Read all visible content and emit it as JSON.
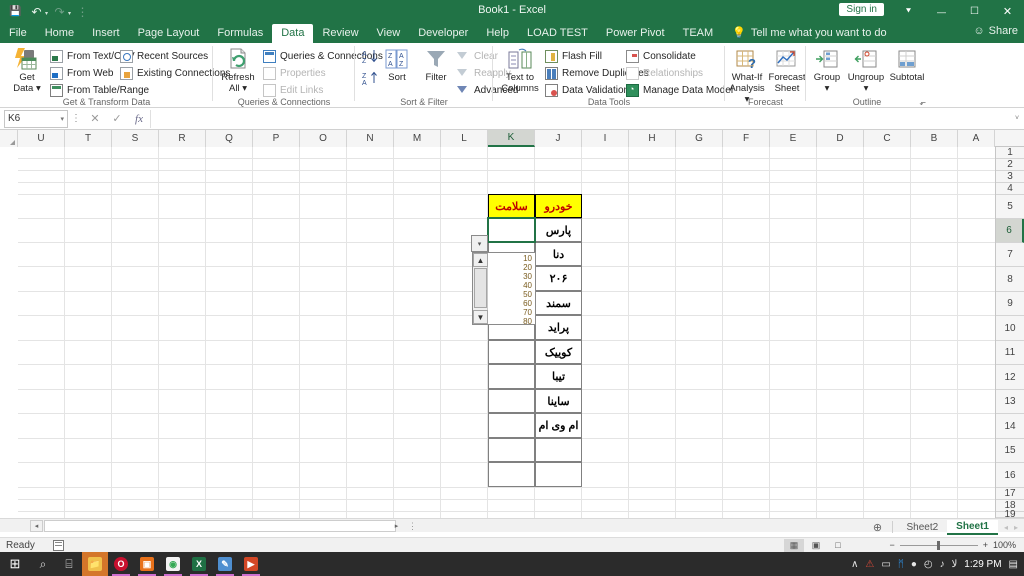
{
  "titlebar": {
    "app_title": "Book1  -  Excel",
    "signin_label": "Sign in",
    "quick_access": [
      {
        "name": "save-icon",
        "glyph": "💾"
      },
      {
        "name": "undo-icon",
        "glyph": "↶"
      },
      {
        "name": "redo-icon",
        "glyph": "↷"
      },
      {
        "name": "customize-qat-icon",
        "glyph": "⋮"
      }
    ],
    "window_buttons": [
      {
        "name": "ribbon-display-options-icon",
        "glyph": "⯆"
      },
      {
        "name": "minimize-icon",
        "glyph": "—"
      },
      {
        "name": "restore-icon",
        "glyph": "☐"
      },
      {
        "name": "close-icon",
        "glyph": "✕"
      }
    ],
    "share_label": "Share"
  },
  "tabs": [
    {
      "label": "File",
      "active": false
    },
    {
      "label": "Home",
      "active": false
    },
    {
      "label": "Insert",
      "active": false
    },
    {
      "label": "Page Layout",
      "active": false
    },
    {
      "label": "Formulas",
      "active": false
    },
    {
      "label": "Data",
      "active": true
    },
    {
      "label": "Review",
      "active": false
    },
    {
      "label": "View",
      "active": false
    },
    {
      "label": "Developer",
      "active": false
    },
    {
      "label": "Help",
      "active": false
    },
    {
      "label": "LOAD TEST",
      "active": false
    },
    {
      "label": "Power Pivot",
      "active": false
    },
    {
      "label": "TEAM",
      "active": false
    }
  ],
  "tell_me": "Tell me what you want to do",
  "ribbon": {
    "groups": [
      {
        "title": "Get & Transform Data"
      },
      {
        "title": "Queries & Connections"
      },
      {
        "title": "Sort & Filter"
      },
      {
        "title": "Data Tools"
      },
      {
        "title": "Forecast"
      },
      {
        "title": "Outline"
      }
    ],
    "get_data": {
      "line1": "Get",
      "line2": "Data",
      "caret": "▾"
    },
    "get_transform_items": [
      {
        "label": "From Text/CSV",
        "disabled": false
      },
      {
        "label": "From Web",
        "disabled": false
      },
      {
        "label": "From Table/Range",
        "disabled": false
      },
      {
        "label": "Recent Sources",
        "disabled": false
      },
      {
        "label": "Existing Connections",
        "disabled": false
      }
    ],
    "refresh_all": {
      "line1": "Refresh",
      "line2": "All ▾"
    },
    "queries_items": [
      {
        "label": "Queries & Connections",
        "disabled": false
      },
      {
        "label": "Properties",
        "disabled": true
      },
      {
        "label": "Edit Links",
        "disabled": true
      }
    ],
    "sort_label": "Sort",
    "filter_label": "Filter",
    "sort_filter_items": [
      {
        "label": "Clear",
        "disabled": true
      },
      {
        "label": "Reapply",
        "disabled": true
      },
      {
        "label": "Advanced",
        "disabled": false
      }
    ],
    "text_to_columns": {
      "line1": "Text to",
      "line2": "Columns"
    },
    "data_tools_items": [
      {
        "label": "Flash Fill",
        "disabled": false
      },
      {
        "label": "Remove Duplicates",
        "disabled": false
      },
      {
        "label": "Data Validation   ▾",
        "disabled": false
      },
      {
        "label": "Consolidate",
        "disabled": false
      },
      {
        "label": "Relationships",
        "disabled": true
      },
      {
        "label": "Manage Data Model",
        "disabled": false
      }
    ],
    "what_if": {
      "line1": "What-If",
      "line2": "Analysis ▾"
    },
    "forecast_sheet": {
      "line1": "Forecast",
      "line2": "Sheet"
    },
    "group_btn": {
      "line1": "Group",
      "line2": "▾"
    },
    "ungroup_btn": {
      "line1": "Ungroup",
      "line2": "▾"
    },
    "subtotal_btn": {
      "line1": "Subtotal",
      "line2": ""
    },
    "dialog_launcher": "⬐"
  },
  "formula_bar": {
    "name_box_value": "K6",
    "name_box_caret": "▾",
    "more_dots": "⋮",
    "cancel_icon": "✕",
    "enter_icon": "✓",
    "fx_icon": "fx",
    "formula_value": "",
    "expand_caret": "˅"
  },
  "grid": {
    "columns": [
      "U",
      "T",
      "S",
      "R",
      "Q",
      "P",
      "O",
      "N",
      "M",
      "L",
      "K",
      "J",
      "I",
      "H",
      "G",
      "F",
      "E",
      "D",
      "C",
      "B",
      "A"
    ],
    "selected_column": "K",
    "rows": [
      "1",
      "2",
      "3",
      "4",
      "5",
      "6",
      "7",
      "8",
      "9",
      "10",
      "11",
      "12",
      "13",
      "14",
      "15",
      "16",
      "17",
      "18",
      "19"
    ],
    "selected_row": "6",
    "active_cell": "K6",
    "header_cells": [
      {
        "ref": "K5",
        "text": "سلامت"
      },
      {
        "ref": "J5",
        "text": "خودرو"
      }
    ],
    "column_j_values": [
      {
        "ref": "J6",
        "text": "پارس"
      },
      {
        "ref": "J7",
        "text": "دنا"
      },
      {
        "ref": "J8",
        "text": "۲۰۶"
      },
      {
        "ref": "J9",
        "text": "سمند"
      },
      {
        "ref": "J10",
        "text": "پراید"
      },
      {
        "ref": "J11",
        "text": "کوییک"
      },
      {
        "ref": "J12",
        "text": "تیبا"
      },
      {
        "ref": "J13",
        "text": "ساینا"
      },
      {
        "ref": "J14",
        "text": "ام وی ام"
      },
      {
        "ref": "J15",
        "text": ""
      },
      {
        "ref": "J16",
        "text": ""
      }
    ],
    "column_k_values": [
      {
        "ref": "K6",
        "text": ""
      },
      {
        "ref": "K7",
        "text": ""
      },
      {
        "ref": "K8",
        "text": ""
      },
      {
        "ref": "K9",
        "text": ""
      },
      {
        "ref": "K10",
        "text": ""
      },
      {
        "ref": "K11",
        "text": ""
      },
      {
        "ref": "K12",
        "text": ""
      },
      {
        "ref": "K13",
        "text": ""
      },
      {
        "ref": "K14",
        "text": ""
      },
      {
        "ref": "K15",
        "text": ""
      },
      {
        "ref": "K16",
        "text": ""
      }
    ],
    "header_fill_color": "#ffff00",
    "header_text_color": "#c00000",
    "selection_color": "#217346"
  },
  "validation_dropdown": {
    "button_glyph": "▾",
    "scroll_up_glyph": "▲",
    "scroll_down_glyph": "▼",
    "options": [
      "10",
      "20",
      "30",
      "40",
      "50",
      "60",
      "70",
      "80"
    ]
  },
  "sheet_bar": {
    "add_sheet_glyph": "⊕",
    "nav_prev": "◂",
    "nav_next": "▸",
    "tabs": [
      {
        "label": "Sheet2",
        "active": false
      },
      {
        "label": "Sheet1",
        "active": true
      }
    ]
  },
  "hscroll": {
    "left_glyph": "◂",
    "right_glyph": "▸",
    "dots": "⋮"
  },
  "status_bar": {
    "status_text": "Ready",
    "view_buttons": [
      {
        "name": "normal-view-button",
        "glyph": "▦",
        "active": true
      },
      {
        "name": "page-layout-view-button",
        "glyph": "▣",
        "active": false
      },
      {
        "name": "page-break-preview-button",
        "glyph": "□",
        "active": false
      }
    ],
    "zoom_out": "−",
    "zoom_in": "+",
    "zoom_level": "100%"
  },
  "taskbar": {
    "start_glyph": "⊞",
    "search_glyph": "⌕",
    "taskview_glyph": "⌸",
    "apps": [
      {
        "name": "file-explorer-icon",
        "glyph": "📁",
        "color": "#f0c14b",
        "active": true,
        "open": false
      },
      {
        "name": "opera-icon",
        "glyph": "O",
        "color": "#c8102e",
        "active": false,
        "open": false
      },
      {
        "name": "photos-icon",
        "glyph": "▣",
        "color": "#e8711a",
        "active": false,
        "open": true
      },
      {
        "name": "chrome-icon",
        "glyph": "◉",
        "color": "#34a853",
        "active": false,
        "open": true
      },
      {
        "name": "excel-icon",
        "glyph": "X",
        "color": "#1f7044",
        "active": false,
        "open": true
      },
      {
        "name": "paint-icon",
        "glyph": "✎",
        "color": "#4f8fd0",
        "active": false,
        "open": true
      },
      {
        "name": "powerpoint-icon",
        "glyph": "▶",
        "color": "#d24726",
        "active": false,
        "open": true
      }
    ],
    "tray": [
      {
        "name": "show-hidden-icons",
        "glyph": "∧"
      },
      {
        "name": "warning-icon",
        "glyph": "⚠"
      },
      {
        "name": "battery-icon",
        "glyph": "▭"
      },
      {
        "name": "bluetooth-icon",
        "glyph": "ᛗ"
      },
      {
        "name": "microphone-icon",
        "glyph": "Ἲ4"
      },
      {
        "name": "wifi-icon",
        "glyph": "◴"
      },
      {
        "name": "volume-icon",
        "glyph": "ὐA"
      },
      {
        "name": "language-icon",
        "glyph": "لا"
      }
    ],
    "clock": "1:29 PM",
    "notification_glyph": "▤"
  }
}
